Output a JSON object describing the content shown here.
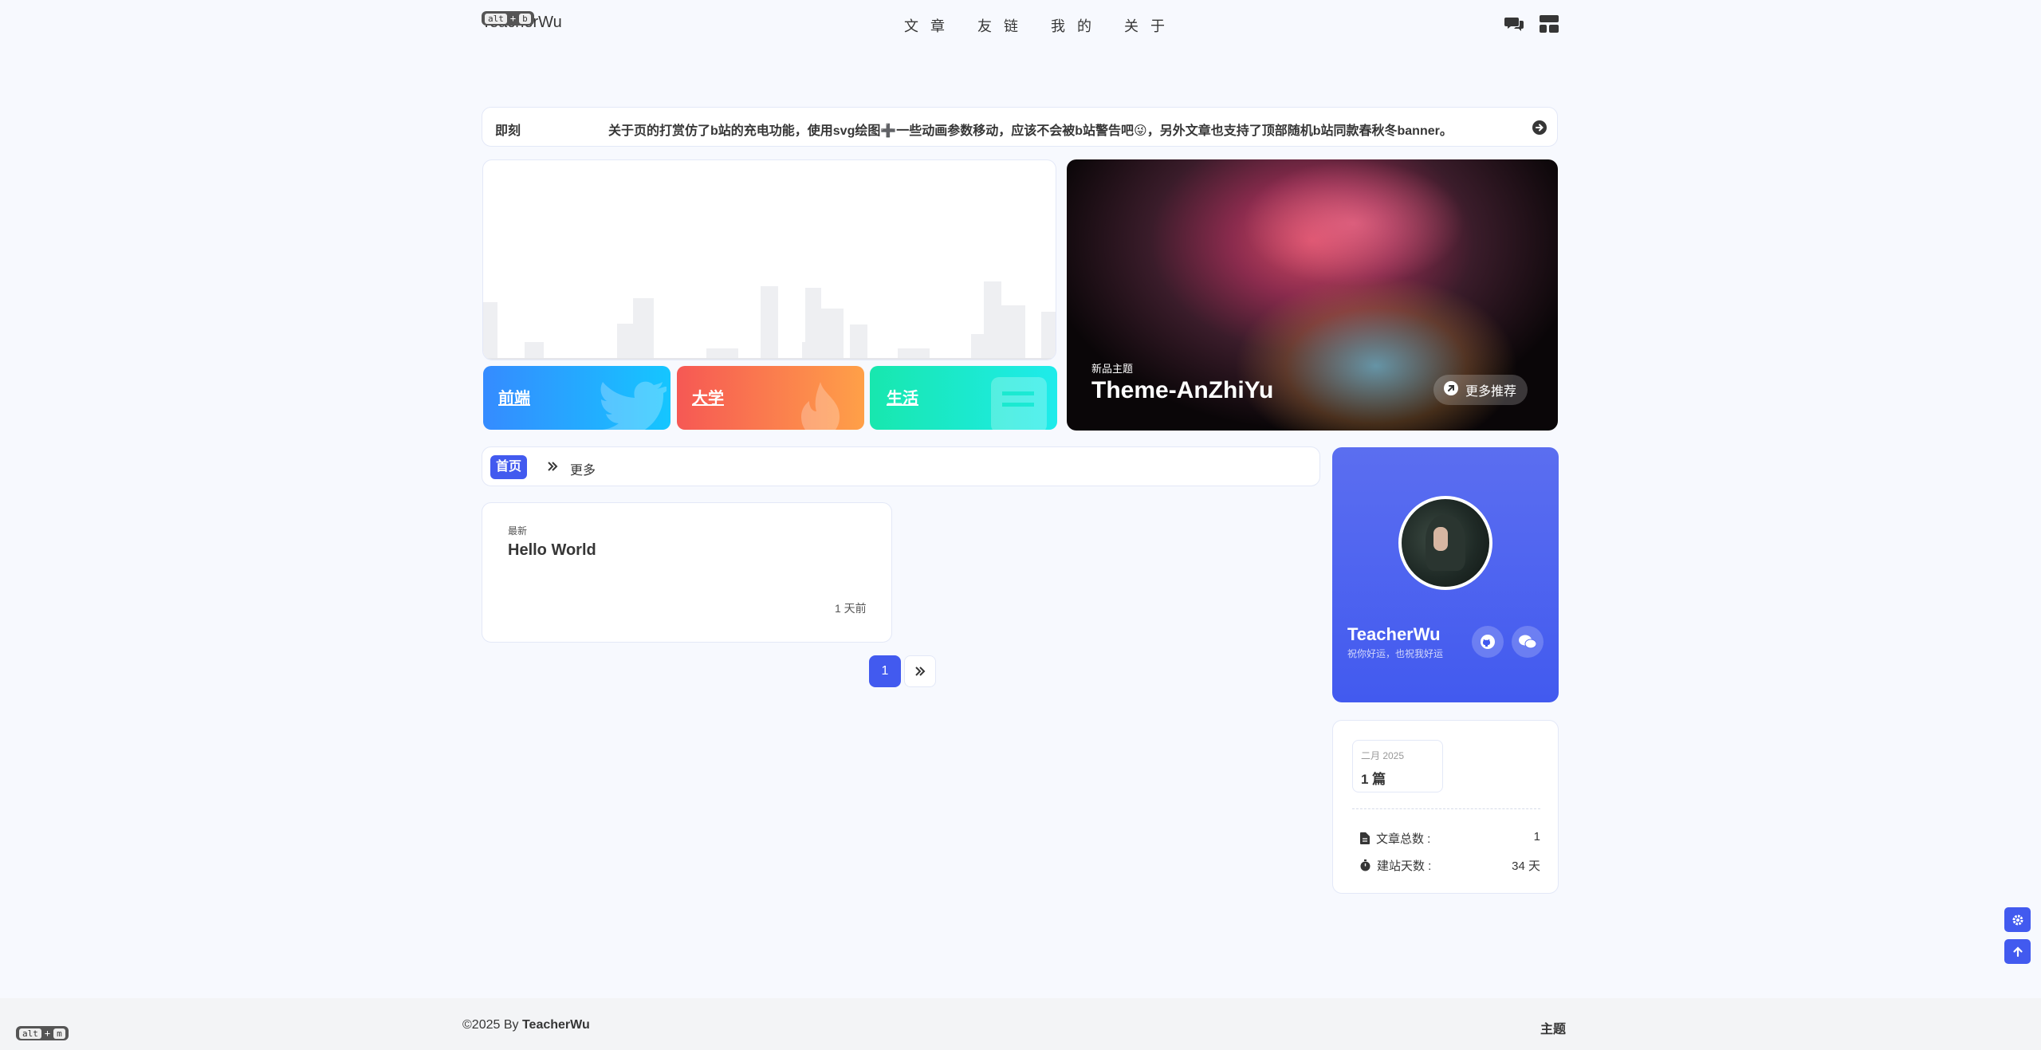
{
  "header": {
    "logo_text": "TeacherWu",
    "shortcut_key": "alt",
    "shortcut_letter": "b",
    "nav": [
      "文 章",
      "友 链",
      "我 的",
      "关 于"
    ]
  },
  "notice": {
    "label": "即刻",
    "text": "关于页的打赏仿了b站的充电功能，使用svg绘图➕一些动画参数移动，应该不会被b站警告吧😜，另外文章也支持了顶部随机b站同款春秋冬banner。"
  },
  "categories": [
    {
      "label": "前端",
      "color": "#3c8cf5"
    },
    {
      "label": "大学",
      "color": "#f86a4f"
    },
    {
      "label": "生活",
      "color": "#1fe0b3"
    }
  ],
  "featured": {
    "tag": "新品主题",
    "title": "Theme-AnZhiYu",
    "more_label": "更多推荐"
  },
  "tabs": {
    "home": "首页",
    "more": "更多"
  },
  "post": {
    "badge": "最新",
    "title": "Hello World",
    "time": "1 天前"
  },
  "pagination": {
    "current": "1"
  },
  "author": {
    "name": "TeacherWu",
    "desc": "祝你好运，也祝我好运"
  },
  "archive": {
    "month": "二月 2025",
    "count": "1 篇"
  },
  "stats": [
    {
      "label": "文章总数 :",
      "value": "1"
    },
    {
      "label": "建站天数 :",
      "value": "34 天"
    }
  ],
  "footer": {
    "copyright_prefix": "©2025 By ",
    "author": "TeacherWu",
    "theme_label": "主题",
    "shortcut_key": "alt",
    "shortcut_letter": "m"
  },
  "colors": {
    "accent": "#425aef",
    "background": "#f7f9fe"
  }
}
